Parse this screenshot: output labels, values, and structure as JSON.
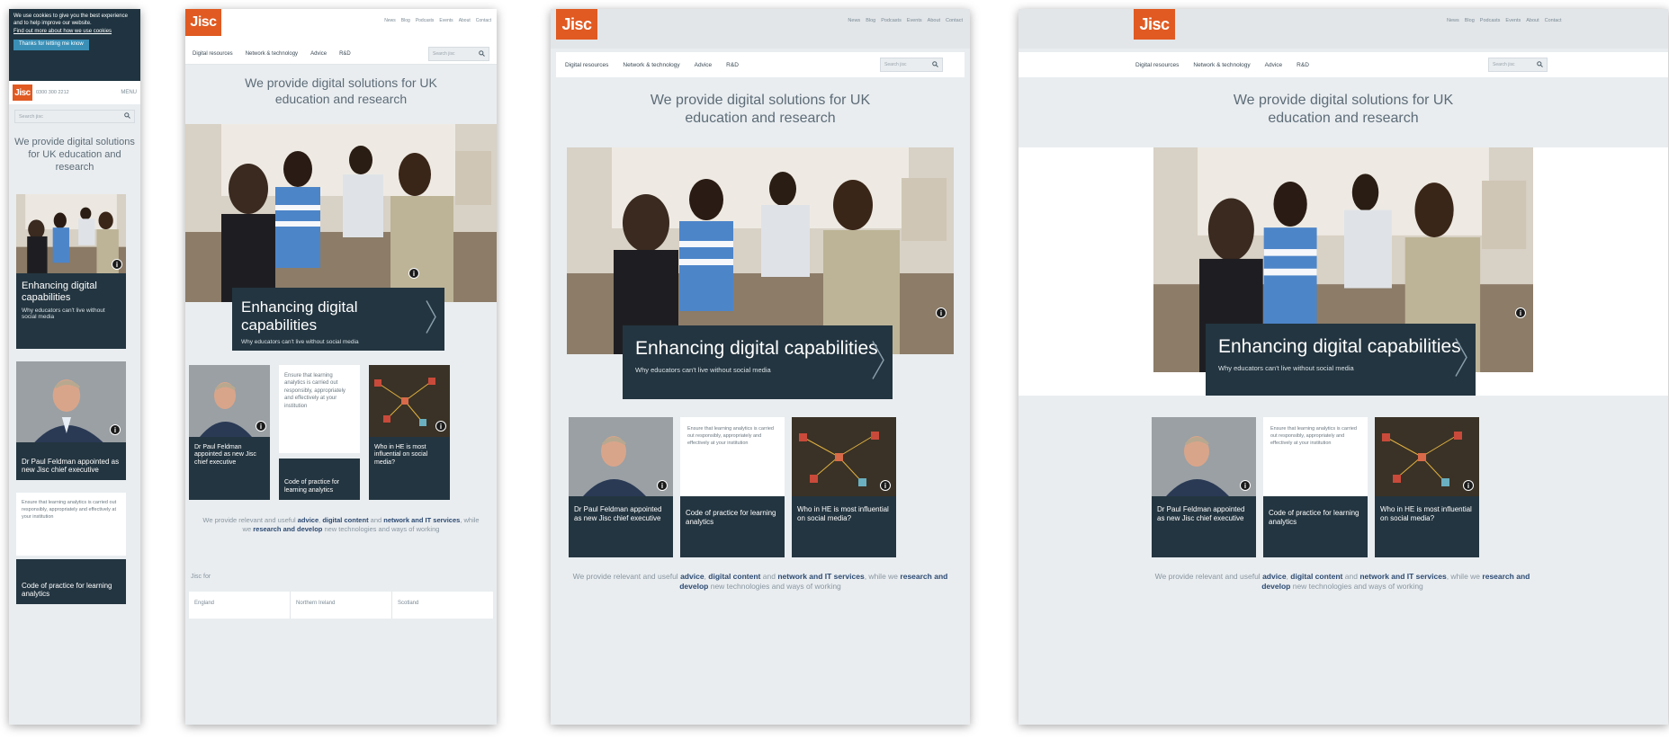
{
  "brand": {
    "logo_text": "Jisc",
    "logo_color": "#e05a22",
    "navy": "#233540"
  },
  "util_nav": [
    "News",
    "Blog",
    "Podcasts",
    "Events",
    "About",
    "Contact"
  ],
  "main_nav": [
    "Digital resources",
    "Network & technology",
    "Advice",
    "R&D"
  ],
  "search": {
    "placeholder": "Search jisc",
    "icon": "search-icon"
  },
  "headline": "We provide digital solutions for UK education and research",
  "hero": {
    "title": "Enhancing digital capabilities",
    "subtitle": "Why educators can't live without social media"
  },
  "tiles": {
    "feldman": "Dr Paul Feldman appointed as new Jisc chief executive",
    "analytics_blurb": "Ensure that learning analytics is carried out responsibly, appropriately and effectively at your institution",
    "analytics_title": "Code of practice for learning analytics",
    "influential": "Who in HE is most influential on social media?"
  },
  "intro": {
    "pre": "We provide relevant and useful",
    "advice": "advice",
    "comma": ",",
    "digital": "digital content",
    "and": "and",
    "network": "network and IT services",
    "while": ", while we",
    "research": "research and develop",
    "post": "new technologies and ways of working"
  },
  "jisc_for": {
    "label": "Jisc for",
    "items": [
      "England",
      "Northern Ireland",
      "Scotland"
    ]
  },
  "mobile": {
    "cookie_text": "We use cookies to give you the best experience and to help improve our website.",
    "cookie_link": "Find out more about how we use cookies",
    "cookie_button": "Thanks for letting me know",
    "phone": "0300 300 2212",
    "menu": "MENU",
    "headline": "We provide digital solutions for UK education and research",
    "hero_title": "Enhancing digital capabilities",
    "hero_subtitle": "Why educators can't live without social media",
    "feldman": "Dr Paul Feldman appointed as new Jisc chief executive",
    "analytics_blurb": "Ensure that learning analytics is carried out responsibly, appropriately and effectively at your institution",
    "analytics_title": "Code of practice for learning analytics"
  },
  "info_glyph": "i"
}
